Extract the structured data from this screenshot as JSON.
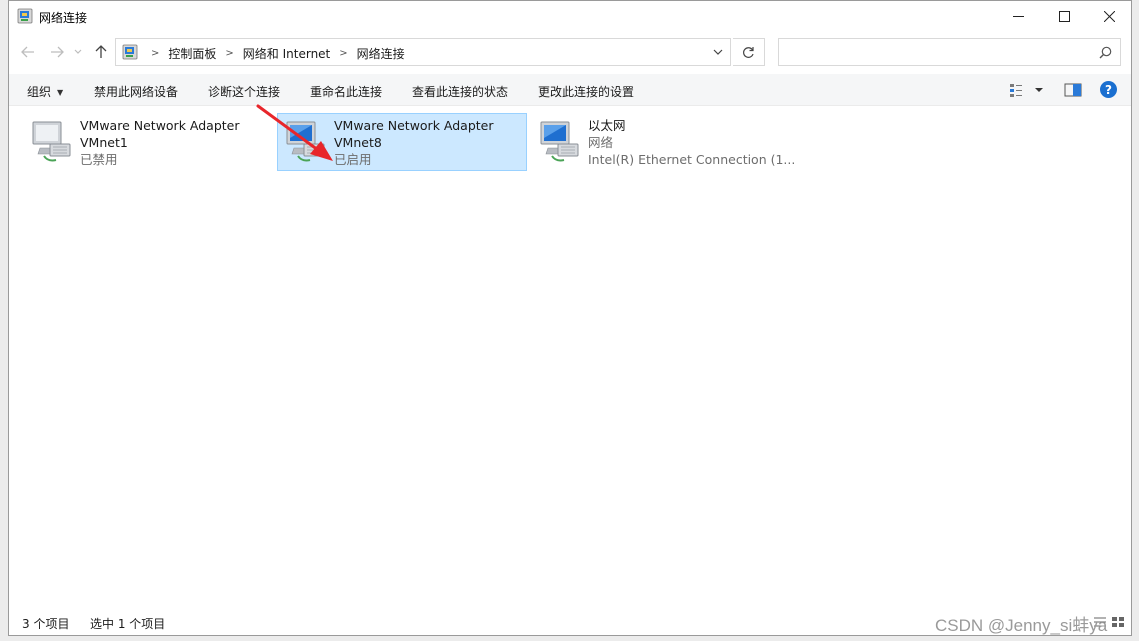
{
  "window": {
    "title": "网络连接"
  },
  "nav": {
    "breadcrumbs": [
      "控制面板",
      "网络和 Internet",
      "网络连接"
    ],
    "search_placeholder": ""
  },
  "toolbar": {
    "organize": "组织",
    "disable_device": "禁用此网络设备",
    "diagnose": "诊断这个连接",
    "rename": "重命名此连接",
    "view_status": "查看此连接的状态",
    "change_settings": "更改此连接的设置"
  },
  "adapters": [
    {
      "name": "VMware Network Adapter",
      "sub": "VMnet1",
      "status": "已禁用",
      "selected": false
    },
    {
      "name": "VMware Network Adapter",
      "sub": "VMnet8",
      "status": "已启用",
      "selected": true
    },
    {
      "name": "以太网",
      "sub": "网络",
      "status": "Intel(R) Ethernet Connection (1...",
      "selected": false
    }
  ],
  "statusbar": {
    "item_count": "3 个项目",
    "selected_count": "选中 1 个项目"
  },
  "watermark": "CSDN @Jenny_si蚌ya",
  "colors": {
    "selection_bg": "#cce8ff",
    "selection_border": "#99d1ff",
    "annotation_arrow": "#e8262b",
    "help_blue": "#1a6fd0"
  },
  "icons": {
    "title": "network-connections-icon",
    "adapter": "network-adapter-icon",
    "search": "search-icon",
    "refresh": "refresh-icon",
    "help": "help-icon"
  }
}
